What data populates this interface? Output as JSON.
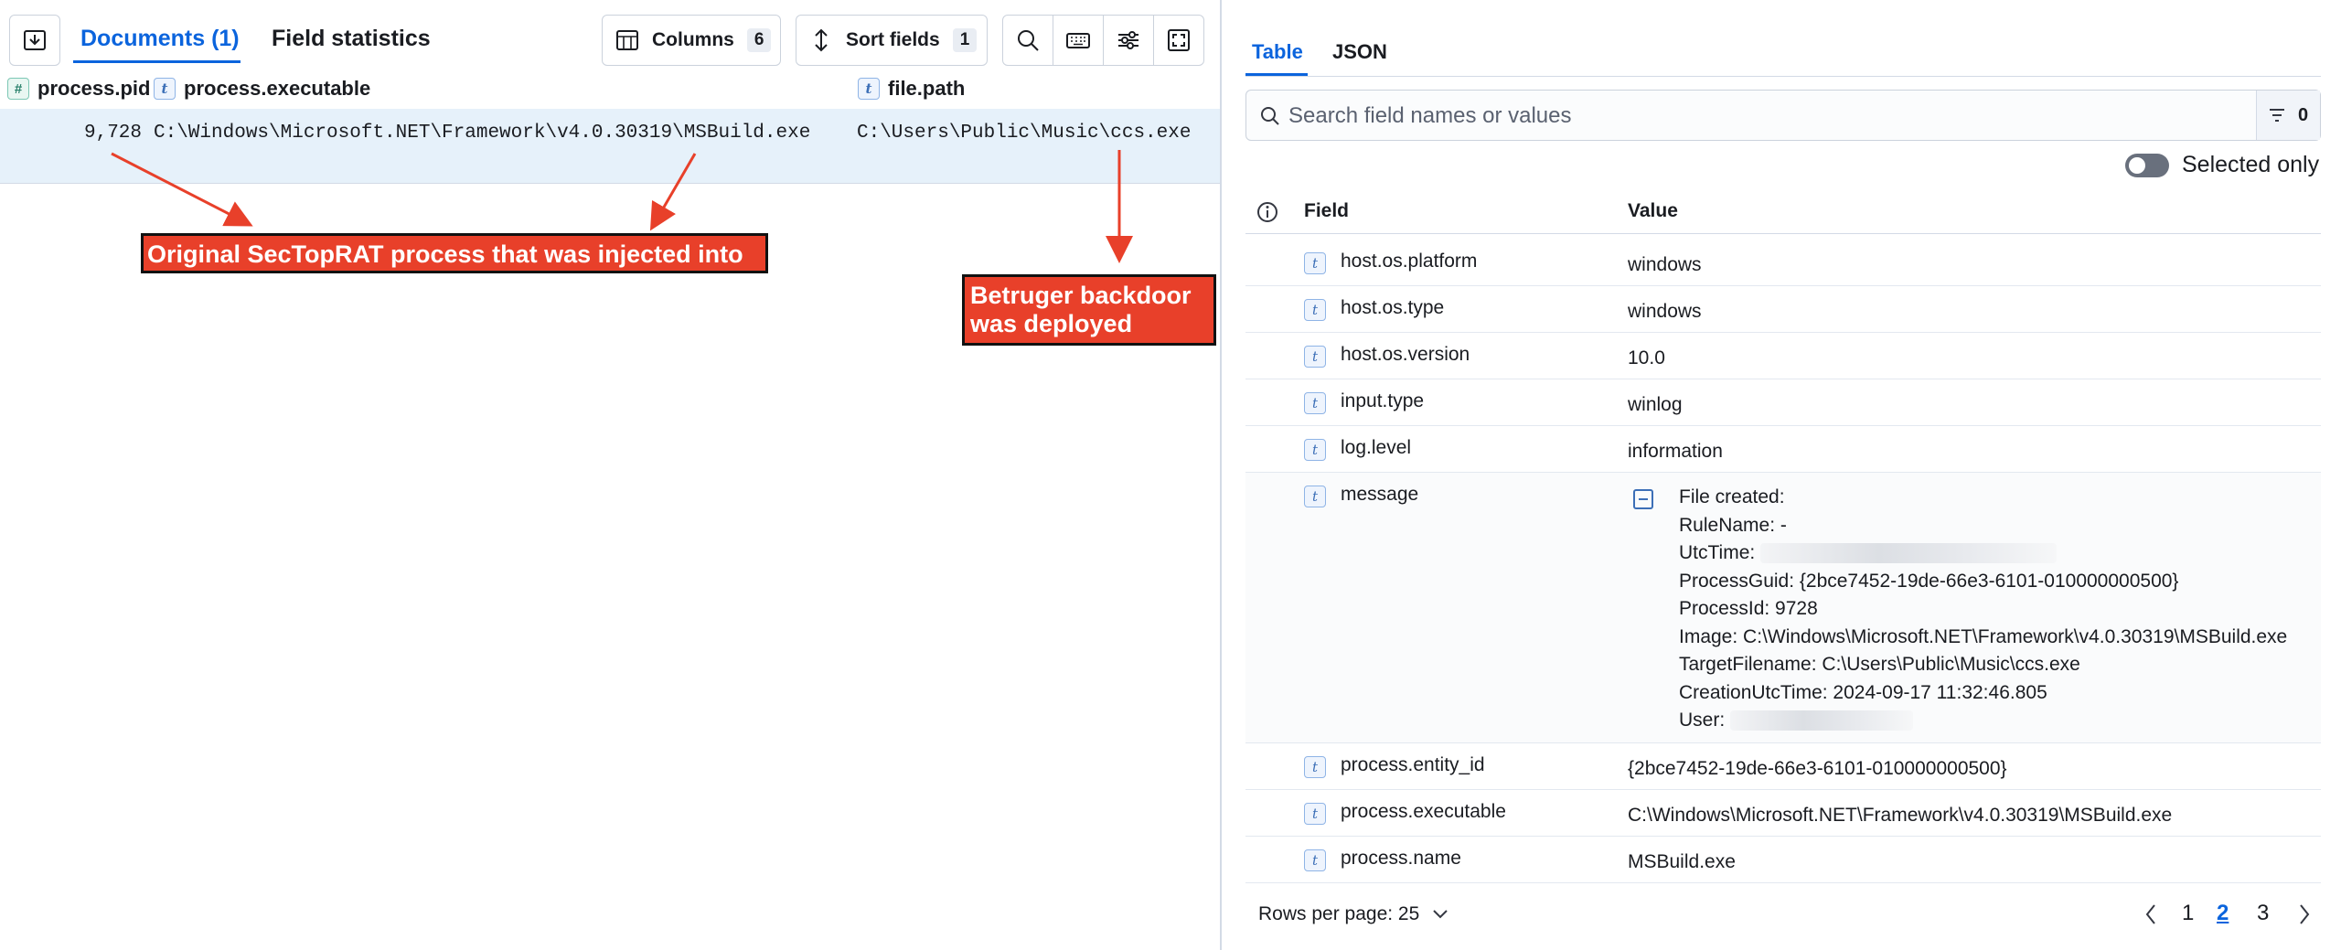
{
  "left": {
    "tabs": {
      "documents": "Documents (1)",
      "field_statistics": "Field statistics"
    },
    "toolbar": {
      "columns_label": "Columns",
      "columns_count": "6",
      "sort_label": "Sort fields",
      "sort_count": "1"
    },
    "columns": [
      {
        "type": "#",
        "name": "process.pid"
      },
      {
        "type": "t",
        "name": "process.executable"
      },
      {
        "type": "t",
        "name": "file.path"
      }
    ],
    "row": {
      "pid": "9,728",
      "executable": "C:\\Windows\\Microsoft.NET\\Framework\\v4.0.30319\\MSBuild.exe",
      "file_path": "C:\\Users\\Public\\Music\\ccs.exe"
    },
    "annotations": {
      "injected": "Original SecTopRAT process that was injected into",
      "backdoor_line1": "Betruger backdoor",
      "backdoor_line2": "was deployed"
    }
  },
  "right": {
    "tabs": {
      "table": "Table",
      "json": "JSON"
    },
    "search": {
      "placeholder": "Search field names or values",
      "filter_count": "0"
    },
    "selected_only": "Selected only",
    "headers": {
      "field": "Field",
      "value": "Value"
    },
    "rows": [
      {
        "type": "t",
        "field": "host.os.platform",
        "value": "windows"
      },
      {
        "type": "t",
        "field": "host.os.type",
        "value": "windows"
      },
      {
        "type": "t",
        "field": "host.os.version",
        "value": "10.0"
      },
      {
        "type": "t",
        "field": "input.type",
        "value": "winlog"
      },
      {
        "type": "t",
        "field": "log.level",
        "value": "information"
      },
      {
        "type": "t",
        "field": "message",
        "value": ""
      },
      {
        "type": "t",
        "field": "process.entity_id",
        "value": "{2bce7452-19de-66e3-6101-010000000500}"
      },
      {
        "type": "t",
        "field": "process.executable",
        "value": "C:\\Windows\\Microsoft.NET\\Framework\\v4.0.30319\\MSBuild.exe"
      },
      {
        "type": "t",
        "field": "process.name",
        "value": "MSBuild.exe"
      }
    ],
    "message_lines": {
      "l1": "File created:",
      "l2": "RuleName: -",
      "l3": "UtcTime:",
      "l4": "ProcessGuid: {2bce7452-19de-66e3-6101-010000000500}",
      "l5": "ProcessId: 9728",
      "l6": "Image: C:\\Windows\\Microsoft.NET\\Framework\\v4.0.30319\\MSBuild.exe",
      "l7": "TargetFilename: C:\\Users\\Public\\Music\\ccs.exe",
      "l8": "CreationUtcTime: 2024-09-17 11:32:46.805",
      "l9": "User:"
    },
    "footer": {
      "rows_per_page": "Rows per page: 25",
      "pages": [
        "1",
        "2",
        "3"
      ]
    }
  }
}
